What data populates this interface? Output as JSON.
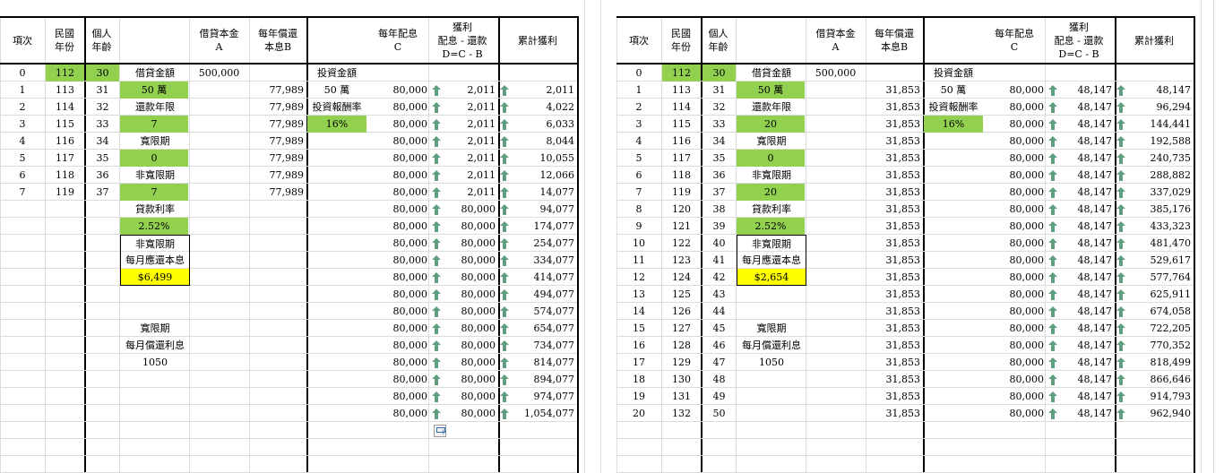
{
  "colors": {
    "green": "#92d050",
    "yellow": "#ffff00",
    "arrow": "#5f9f7f"
  },
  "left": {
    "headers": {
      "seq": "項次",
      "year": "民國\n年份",
      "age": "個人\n年齡",
      "principal": "借貸本金\nA",
      "repay": "每年償還\n本息B",
      "dividend": "每年配息\nC",
      "profit": "獲利\n配息 - 還款\nD=C - B",
      "cumulative": "累計獲利"
    },
    "seq": [
      "0",
      "1",
      "2",
      "3",
      "4",
      "5",
      "6",
      "7"
    ],
    "years": [
      "112",
      "113",
      "114",
      "115",
      "116",
      "117",
      "118",
      "119"
    ],
    "ages": [
      "30",
      "31",
      "32",
      "33",
      "34",
      "35",
      "36",
      "37"
    ],
    "params": [
      "借貸金額",
      "50 萬",
      "還款年限",
      "7",
      "寬限期",
      "0",
      "非寬限期",
      "7",
      "貸款利率",
      "2.52%",
      "非寬限期",
      "每月應還本息",
      "$6,499",
      "",
      "",
      "寬限期",
      "每月償還利息",
      "1050"
    ],
    "principal": "500,000",
    "repay": [
      "",
      "77,989",
      "77,989",
      "77,989",
      "77,989",
      "77,989",
      "77,989",
      "77,989"
    ],
    "invest": [
      "投資金額",
      "50 萬",
      "投資報酬率",
      "16%"
    ],
    "dividend": [
      "80,000",
      "80,000",
      "80,000",
      "80,000",
      "80,000",
      "80,000",
      "80,000",
      "80,000",
      "80,000",
      "80,000",
      "80,000",
      "80,000",
      "80,000",
      "80,000",
      "80,000",
      "80,000",
      "80,000",
      "80,000",
      "80,000",
      "80,000"
    ],
    "profit": [
      "2,011",
      "2,011",
      "2,011",
      "2,011",
      "2,011",
      "2,011",
      "2,011",
      "80,000",
      "80,000",
      "80,000",
      "80,000",
      "80,000",
      "80,000",
      "80,000",
      "80,000",
      "80,000",
      "80,000",
      "80,000",
      "80,000",
      "80,000"
    ],
    "cumulative": [
      "2,011",
      "4,022",
      "6,033",
      "8,044",
      "10,055",
      "12,066",
      "14,077",
      "94,077",
      "174,077",
      "254,077",
      "334,077",
      "414,077",
      "494,077",
      "574,077",
      "654,077",
      "734,077",
      "814,077",
      "894,077",
      "974,077",
      "1,054,077"
    ]
  },
  "right": {
    "headers": {
      "seq": "項次",
      "year": "民國\n年份",
      "age": "個人\n年齡",
      "principal": "借貸本金\nA",
      "repay": "每年償還\n本息B",
      "dividend": "每年配息\nC",
      "profit": "獲利\n配息 - 還款\nD=C - B",
      "cumulative": "累計獲利"
    },
    "seq": [
      "0",
      "1",
      "2",
      "3",
      "4",
      "5",
      "6",
      "7",
      "8",
      "9",
      "10",
      "11",
      "12",
      "13",
      "14",
      "15",
      "16",
      "17",
      "18",
      "19",
      "20"
    ],
    "years": [
      "112",
      "113",
      "114",
      "115",
      "116",
      "117",
      "118",
      "119",
      "120",
      "121",
      "122",
      "123",
      "124",
      "125",
      "126",
      "127",
      "128",
      "129",
      "130",
      "131",
      "132"
    ],
    "ages": [
      "30",
      "31",
      "32",
      "33",
      "34",
      "35",
      "36",
      "37",
      "38",
      "39",
      "40",
      "41",
      "42",
      "43",
      "44",
      "45",
      "46",
      "47",
      "48",
      "49",
      "50"
    ],
    "params": [
      "借貸金額",
      "50 萬",
      "還款年限",
      "20",
      "寬限期",
      "0",
      "非寬限期",
      "20",
      "貸款利率",
      "2.52%",
      "非寬限期",
      "每月應還本息",
      "$2,654",
      "",
      "",
      "寬限期",
      "每月償還利息",
      "1050"
    ],
    "principal": "500,000",
    "repay": [
      "",
      "31,853",
      "31,853",
      "31,853",
      "31,853",
      "31,853",
      "31,853",
      "31,853",
      "31,853",
      "31,853",
      "31,853",
      "31,853",
      "31,853",
      "31,853",
      "31,853",
      "31,853",
      "31,853",
      "31,853",
      "31,853",
      "31,853",
      "31,853"
    ],
    "invest": [
      "投資金額",
      "50 萬",
      "投資報酬率",
      "16%"
    ],
    "dividend": [
      "80,000",
      "80,000",
      "80,000",
      "80,000",
      "80,000",
      "80,000",
      "80,000",
      "80,000",
      "80,000",
      "80,000",
      "80,000",
      "80,000",
      "80,000",
      "80,000",
      "80,000",
      "80,000",
      "80,000",
      "80,000",
      "80,000",
      "80,000"
    ],
    "profit": [
      "48,147",
      "48,147",
      "48,147",
      "48,147",
      "48,147",
      "48,147",
      "48,147",
      "48,147",
      "48,147",
      "48,147",
      "48,147",
      "48,147",
      "48,147",
      "48,147",
      "48,147",
      "48,147",
      "48,147",
      "48,147",
      "48,147",
      "48,147"
    ],
    "cumulative": [
      "48,147",
      "96,294",
      "144,441",
      "192,588",
      "240,735",
      "288,882",
      "337,029",
      "385,176",
      "433,323",
      "481,470",
      "529,617",
      "577,764",
      "625,911",
      "674,058",
      "722,205",
      "770,352",
      "818,499",
      "866,646",
      "914,793",
      "962,940"
    ]
  }
}
